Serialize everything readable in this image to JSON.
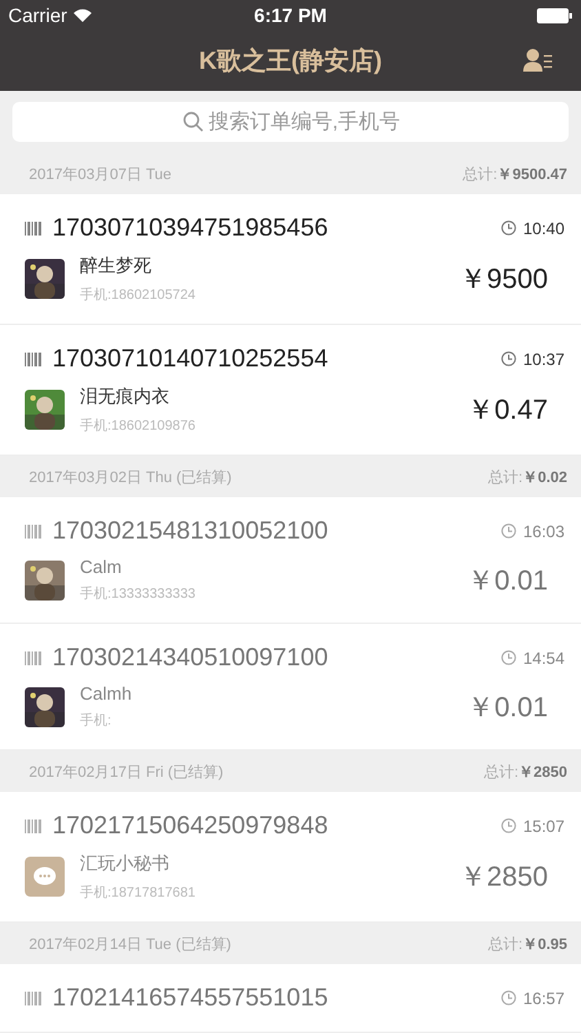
{
  "status_bar": {
    "carrier": "Carrier",
    "time": "6:17 PM"
  },
  "nav": {
    "title": "K歌之王(静安店)"
  },
  "search": {
    "placeholder": "搜索订单编号,手机号"
  },
  "groups": [
    {
      "date": "2017年03月07日 Tue",
      "total_label": "总计:",
      "total": "￥9500.47",
      "settled": false,
      "orders": [
        {
          "number": "17030710394751985456",
          "time": "10:40",
          "name": "醉生梦死",
          "phone": "手机:18602105724",
          "amount": "￥9500"
        },
        {
          "number": "17030710140710252554",
          "time": "10:37",
          "name": "泪无痕内衣",
          "phone": "手机:18602109876",
          "amount": "￥0.47"
        }
      ]
    },
    {
      "date": "2017年03月02日 Thu (已结算)",
      "total_label": "总计:",
      "total": "￥0.02",
      "settled": true,
      "orders": [
        {
          "number": "17030215481310052100",
          "time": "16:03",
          "name": "Calm",
          "phone": "手机:13333333333",
          "amount": "￥0.01"
        },
        {
          "number": "17030214340510097100",
          "time": "14:54",
          "name": "Calmh",
          "phone": "手机:",
          "amount": "￥0.01"
        }
      ]
    },
    {
      "date": "2017年02月17日 Fri (已结算)",
      "total_label": "总计:",
      "total": "￥2850",
      "settled": true,
      "orders": [
        {
          "number": "17021715064250979848",
          "time": "15:07",
          "name": "汇玩小秘书",
          "phone": "手机:18717817681",
          "amount": "￥2850",
          "avatar": {
            "kind": "logo"
          }
        }
      ]
    },
    {
      "date": "2017年02月14日 Tue (已结算)",
      "total_label": "总计:",
      "total": "￥0.95",
      "settled": true,
      "orders": [
        {
          "number": "17021416574557551015",
          "time": "16:57"
        }
      ]
    }
  ]
}
